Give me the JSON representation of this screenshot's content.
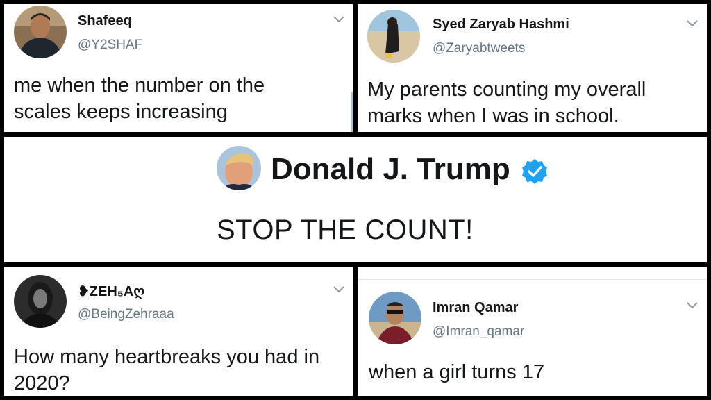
{
  "tweets": [
    {
      "name": "Shafeeq",
      "handle": "@Y2SHAF",
      "text_line1": "me when the number on the",
      "text_line2": "scales keeps increasing"
    },
    {
      "name": "Syed Zaryab Hashmi",
      "handle": "@Zaryabtweets",
      "text_line1": "My parents counting my overall",
      "text_line2": "marks when I was in school."
    },
    {
      "name": "Donald J. Trump",
      "text": "STOP THE COUNT!"
    },
    {
      "name": "❥ZEH₅Aღ",
      "handle": "@BeingZehraaa",
      "text_line1": "How many heartbreaks you had in",
      "text_line2": "2020?"
    },
    {
      "name": "Imran Qamar",
      "handle": "@Imran_qamar",
      "text_line1": "when a girl turns 17"
    }
  ],
  "colors": {
    "verified": "#1da1f2",
    "handle": "#657786",
    "text": "#14171a",
    "border": "#000000"
  },
  "icons": [
    "chevron-down-icon",
    "verified-badge-icon"
  ]
}
